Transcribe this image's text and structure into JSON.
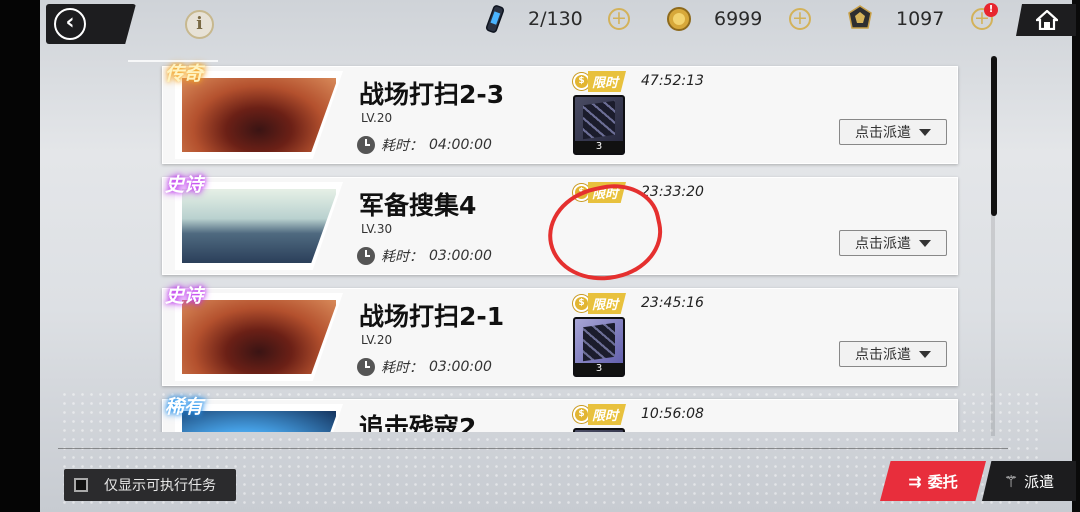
{
  "topbar": {
    "stamina": "2/130",
    "coins": "6999",
    "crystals": "1097",
    "alert_badge": "!",
    "icons": [
      "back-arrow-icon",
      "info-icon",
      "stamina-icon",
      "coin-icon",
      "crystal-icon",
      "plus-icon",
      "home-icon"
    ]
  },
  "missions": [
    {
      "rarity": "传奇",
      "title": "战场打扫2-3",
      "level": "LV.20",
      "duration_label": "耗时：",
      "duration": "04:00:00",
      "limited": "限时",
      "timer": "47:52:13",
      "reward_qty": "3",
      "dispatch": "点击派遣"
    },
    {
      "rarity": "史诗",
      "title": "军备搜集4",
      "level": "LV.30",
      "duration_label": "耗时：",
      "duration": "03:00:00",
      "limited": "限时",
      "timer": "23:33:20",
      "dispatch": "点击派遣"
    },
    {
      "rarity": "史诗",
      "title": "战场打扫2-1",
      "level": "LV.20",
      "duration_label": "耗时：",
      "duration": "03:00:00",
      "limited": "限时",
      "timer": "23:45:16",
      "reward_qty": "3",
      "dispatch": "点击派遣"
    },
    {
      "rarity": "稀有",
      "title": "追击残寇2",
      "limited": "限时",
      "timer": "10:56:08"
    }
  ],
  "footer": {
    "filter_label": "仅显示可执行任务",
    "tab_commission": "委托",
    "tab_dispatch": "派遣"
  },
  "colors": {
    "accent_red": "#e82e3c",
    "legend": "#f2a623",
    "epic": "#c23cf0",
    "rare": "#2d9cf0",
    "limited_gold": "#e8c13d"
  }
}
